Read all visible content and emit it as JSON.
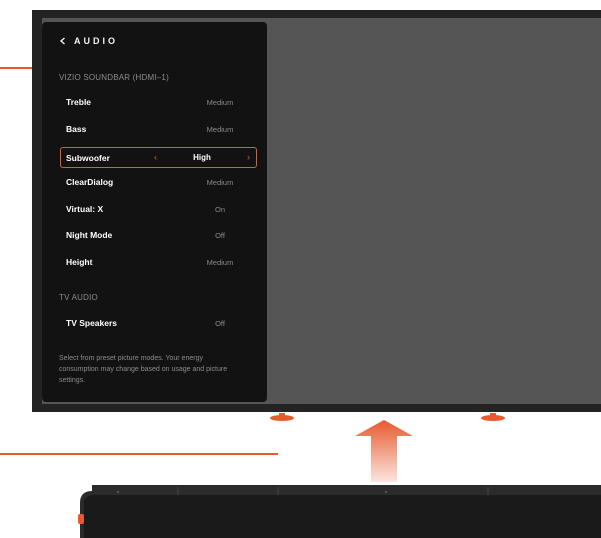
{
  "menu": {
    "title": "AUDIO",
    "back_icon": "chevron-left-icon",
    "sections": [
      {
        "label": "VIZIO SOUNDBAR (HDMI–1)",
        "rows": [
          {
            "label": "Treble",
            "value": "Medium"
          },
          {
            "label": "Bass",
            "value": "Medium"
          },
          {
            "label": "Subwoofer",
            "value": "High",
            "selected": true
          },
          {
            "label": "ClearDialog",
            "value": "Medium"
          },
          {
            "label": "Virtual: X",
            "value": "On"
          },
          {
            "label": "Night Mode",
            "value": "Off"
          },
          {
            "label": "Height",
            "value": "Medium"
          }
        ]
      },
      {
        "label": "TV AUDIO",
        "rows": [
          {
            "label": "TV Speakers",
            "value": "Off"
          }
        ]
      }
    ],
    "footnote": "Select from preset picture modes. Your energy consumption may change based on usage and picture settings."
  },
  "colors": {
    "accent": "#e8592e",
    "panel_bg": "#121212",
    "screen_bg": "#555555",
    "tv_frame": "#232323"
  }
}
